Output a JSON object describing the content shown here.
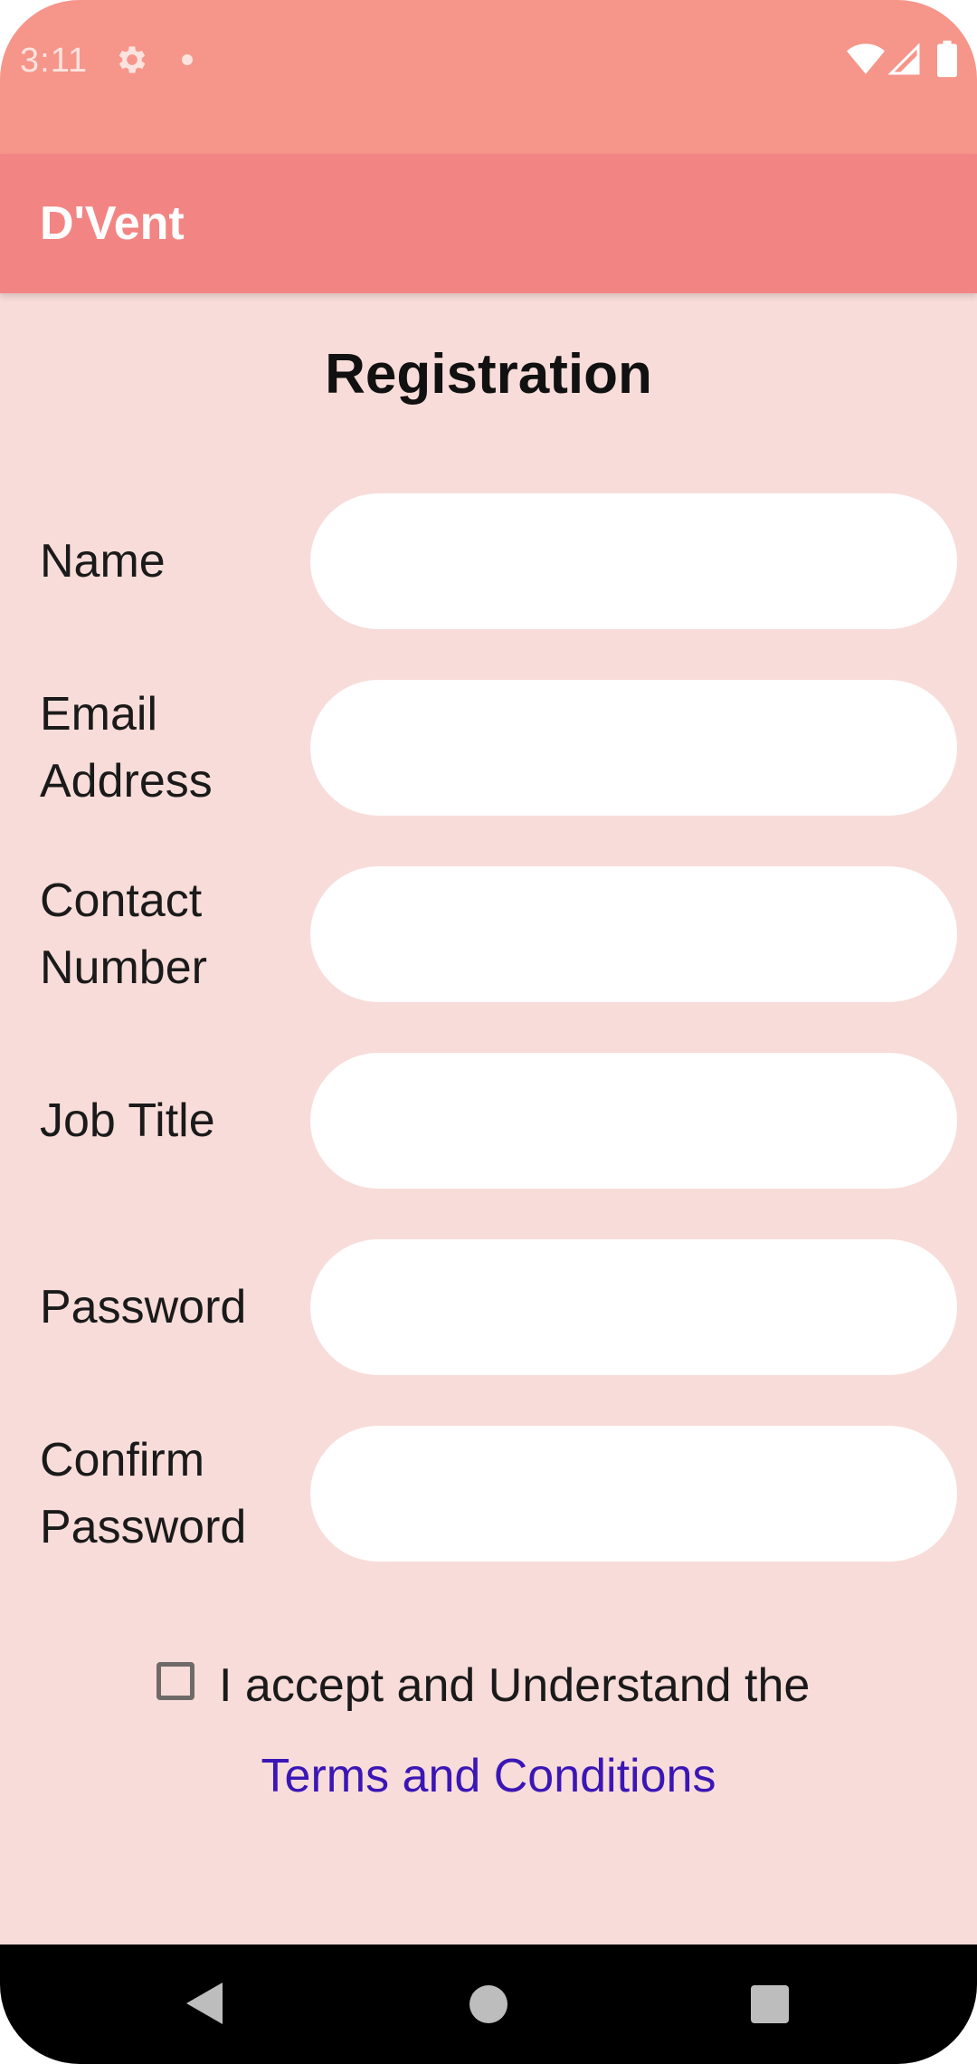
{
  "status_bar": {
    "time": "3:11",
    "icons": [
      "gear-icon",
      "notification-dot-icon",
      "wifi-icon",
      "signal-icon",
      "battery-icon"
    ]
  },
  "app_bar": {
    "title": "D'Vent"
  },
  "page": {
    "title": "Registration"
  },
  "form": {
    "fields": [
      {
        "label": "Name",
        "value": "",
        "placeholder": ""
      },
      {
        "label": "Email Address",
        "value": "",
        "placeholder": ""
      },
      {
        "label": "Contact Number",
        "value": "",
        "placeholder": ""
      },
      {
        "label": "Job Title",
        "value": "",
        "placeholder": ""
      },
      {
        "label": "Password",
        "value": "",
        "placeholder": ""
      },
      {
        "label": "Confirm Password",
        "value": "",
        "placeholder": ""
      }
    ],
    "terms": {
      "checked": false,
      "text": "I accept and Understand the",
      "link": "Terms and Conditions"
    }
  },
  "nav_bar": {
    "icons": [
      "back-icon",
      "home-icon",
      "recent-apps-icon"
    ]
  },
  "colors": {
    "status_bar": "#f6958a",
    "app_bar": "#f28583",
    "background": "#f8dcd9",
    "link": "#3b16b6"
  }
}
